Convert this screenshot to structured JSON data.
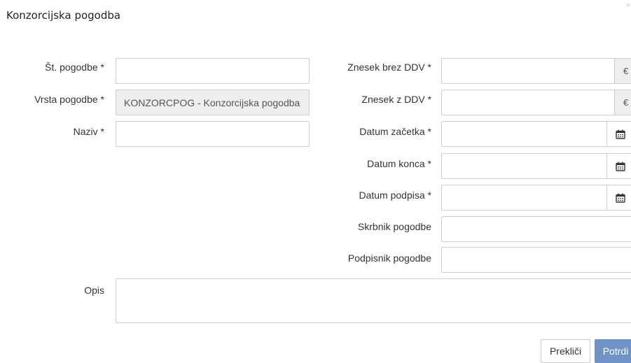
{
  "dialog": {
    "title": "Konzorcijska pogodba",
    "close_glyph": "×"
  },
  "left": {
    "contract_number": {
      "label": "Št. pogodbe *",
      "value": ""
    },
    "contract_type": {
      "label": "Vrsta pogodbe *",
      "value": "KONZORCPOG - Konzorcijska pogodba"
    },
    "name": {
      "label": "Naziv *",
      "value": ""
    }
  },
  "right": {
    "amount_net": {
      "label": "Znesek brez DDV *",
      "value": "",
      "addon": "€"
    },
    "amount_gross": {
      "label": "Znesek z DDV *",
      "value": "",
      "addon": "€"
    },
    "start_date": {
      "label": "Datum začetka *",
      "value": "",
      "icon": "calendar-icon"
    },
    "end_date": {
      "label": "Datum konca *",
      "value": "",
      "icon": "calendar-icon"
    },
    "signing_date": {
      "label": "Datum podpisa *",
      "value": "",
      "icon": "calendar-icon"
    },
    "custodian": {
      "label": "Skrbnik pogodbe",
      "value": ""
    },
    "signatory": {
      "label": "Podpisnik pogodbe",
      "value": ""
    }
  },
  "description": {
    "label": "Opis",
    "value": ""
  },
  "footer": {
    "cancel_label": "Prekliči",
    "confirm_label": "Potrdi"
  },
  "colors": {
    "primary": "#6f93c4",
    "border": "#cccccc",
    "readonly_bg": "#eeeeee"
  }
}
